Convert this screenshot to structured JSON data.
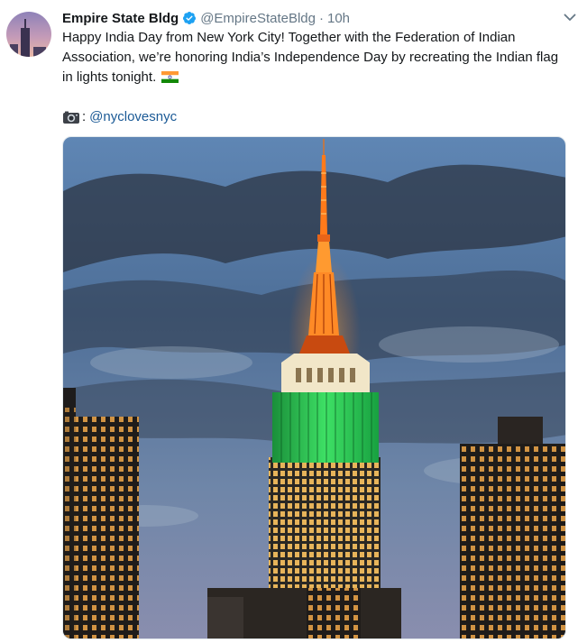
{
  "author": {
    "name": "Empire State Bldg",
    "handle": "@EmpireStateBldg",
    "separator": "·",
    "time": "10h",
    "avatar_icon": "empire-state-avatar",
    "verified_icon": "verified-badge-icon"
  },
  "tweet": {
    "text": "Happy India Day from New York City! Together with the Federation of Indian Association, we’re honoring India’s Independence Day by recreating the Indian flag in lights tonight.",
    "emoji_icon": "india-flag-emoji",
    "credit_separator": ":",
    "credit_mention": "@nyclovesnyc",
    "camera_icon": "camera-icon"
  },
  "menu": {
    "icon": "chevron-down-icon"
  },
  "colors": {
    "text": "#14171a",
    "secondary": "#657786",
    "verified": "#1da1f2",
    "mention": "#1b5a96",
    "flag_saffron": "#ff9933",
    "flag_green": "#138808",
    "tower_green": "#22c24a",
    "tower_orange": "#ff7a1a"
  }
}
